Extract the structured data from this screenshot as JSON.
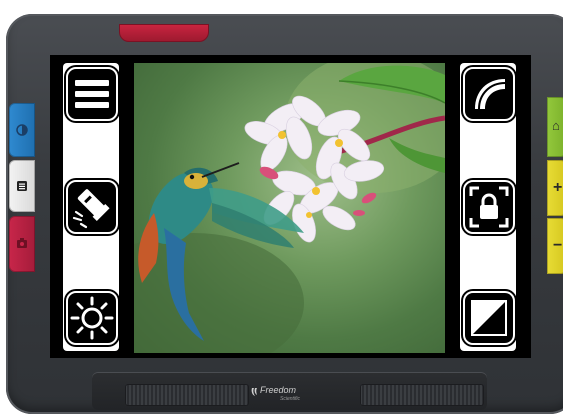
{
  "device": {
    "brand": "Freedom",
    "brand_sub": "Scientific",
    "colors": {
      "body": "#383b3f",
      "power": "#c8243f",
      "blue": "#2f8ad0",
      "white": "#f3f3f3",
      "red": "#c8264a",
      "green": "#93c83c",
      "yellow": "#e8dc35"
    }
  },
  "left_side_buttons": [
    {
      "name": "blue-button",
      "icon": "contrast-icon"
    },
    {
      "name": "white-button",
      "icon": "menu-icon"
    },
    {
      "name": "red-button",
      "icon": "camera-icon"
    }
  ],
  "right_side_buttons": [
    {
      "name": "green-button",
      "icon": "home-icon",
      "glyph": "⌂"
    },
    {
      "name": "plus-button",
      "icon": "plus-icon",
      "glyph": "+"
    },
    {
      "name": "minus-button",
      "icon": "minus-icon",
      "glyph": "−"
    }
  ],
  "screen": {
    "left_tools": [
      {
        "name": "menu-tool-button",
        "icon": "hamburger-menu-icon"
      },
      {
        "name": "flashlight-tool-button",
        "icon": "flashlight-icon"
      },
      {
        "name": "brightness-tool-button",
        "icon": "sun-brightness-icon"
      }
    ],
    "right_tools": [
      {
        "name": "reading-line-tool-button",
        "icon": "curve-guide-icon"
      },
      {
        "name": "focus-lock-tool-button",
        "icon": "lock-icon"
      },
      {
        "name": "contrast-tool-button",
        "icon": "contrast-icon"
      }
    ],
    "image_subject": "hummingbird-and-flowers"
  }
}
